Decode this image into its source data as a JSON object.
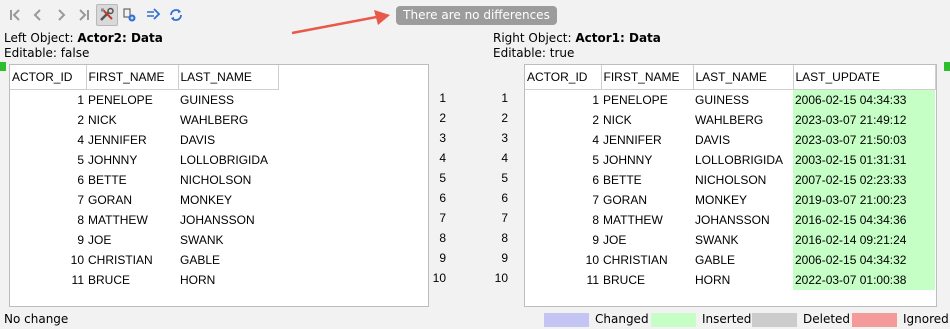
{
  "toolbar": {
    "buttons": [
      {
        "icon": "first-difference-icon",
        "active": false
      },
      {
        "icon": "previous-difference-icon",
        "active": false
      },
      {
        "icon": "next-difference-icon",
        "active": false
      },
      {
        "icon": "last-difference-icon",
        "active": false
      },
      {
        "icon": "tools-icon",
        "active": true
      },
      {
        "icon": "compare-settings-icon",
        "active": false
      },
      {
        "icon": "merge-right-icon",
        "active": false
      },
      {
        "icon": "refresh-icon",
        "active": false
      }
    ],
    "status_message": "There are no differences"
  },
  "left": {
    "object_label": "Left Object:",
    "object_name": "Actor2: Data",
    "editable_text": "Editable: false",
    "columns": [
      "ACTOR_ID",
      "FIRST_NAME",
      "LAST_NAME"
    ],
    "rows": [
      [
        "1",
        "PENELOPE",
        "GUINESS"
      ],
      [
        "2",
        "NICK",
        "WAHLBERG"
      ],
      [
        "4",
        "JENNIFER",
        "DAVIS"
      ],
      [
        "5",
        "JOHNNY",
        "LOLLOBRIGIDA"
      ],
      [
        "6",
        "BETTE",
        "NICHOLSON"
      ],
      [
        "7",
        "GORAN",
        "MONKEY"
      ],
      [
        "8",
        "MATTHEW",
        "JOHANSSON"
      ],
      [
        "9",
        "JOE",
        "SWANK"
      ],
      [
        "10",
        "CHRISTIAN",
        "GABLE"
      ],
      [
        "11",
        "BRUCE",
        "HORN"
      ]
    ]
  },
  "right": {
    "object_label": "Right Object:",
    "object_name": "Actor1: Data",
    "editable_text": "Editable: true",
    "columns": [
      "ACTOR_ID",
      "FIRST_NAME",
      "LAST_NAME",
      "LAST_UPDATE"
    ],
    "rows": [
      [
        "1",
        "PENELOPE",
        "GUINESS",
        "2006-02-15 04:34:33"
      ],
      [
        "2",
        "NICK",
        "WAHLBERG",
        "2023-03-07 21:49:12"
      ],
      [
        "4",
        "JENNIFER",
        "DAVIS",
        "2023-03-07 21:50:03"
      ],
      [
        "5",
        "JOHNNY",
        "LOLLOBRIGIDA",
        "2003-02-15 01:31:31"
      ],
      [
        "6",
        "BETTE",
        "NICHOLSON",
        "2007-02-15 02:23:33"
      ],
      [
        "7",
        "GORAN",
        "MONKEY",
        "2019-03-07 21:00:23"
      ],
      [
        "8",
        "MATTHEW",
        "JOHANSSON",
        "2016-02-15 04:34:36"
      ],
      [
        "9",
        "JOE",
        "SWANK",
        "2016-02-14 09:21:24"
      ],
      [
        "10",
        "CHRISTIAN",
        "GABLE",
        "2006-02-15 04:34:32"
      ],
      [
        "11",
        "BRUCE",
        "HORN",
        "2022-03-07 01:00:38"
      ]
    ]
  },
  "line_numbers": [
    "1",
    "2",
    "3",
    "4",
    "5",
    "6",
    "7",
    "8",
    "9",
    "10"
  ],
  "status_bar": {
    "text": "No change",
    "legend": [
      {
        "label": "Changed",
        "color": "#c4c4f5"
      },
      {
        "label": "Inserted",
        "color": "#c6ffc6"
      },
      {
        "label": "Deleted",
        "color": "#cccccc"
      },
      {
        "label": "Ignored",
        "color": "#f59a9a"
      }
    ]
  },
  "colors": {
    "inserted": "#c6ffc6",
    "marker": "#2dbe2d",
    "annotation_arrow": "#e8594a"
  }
}
